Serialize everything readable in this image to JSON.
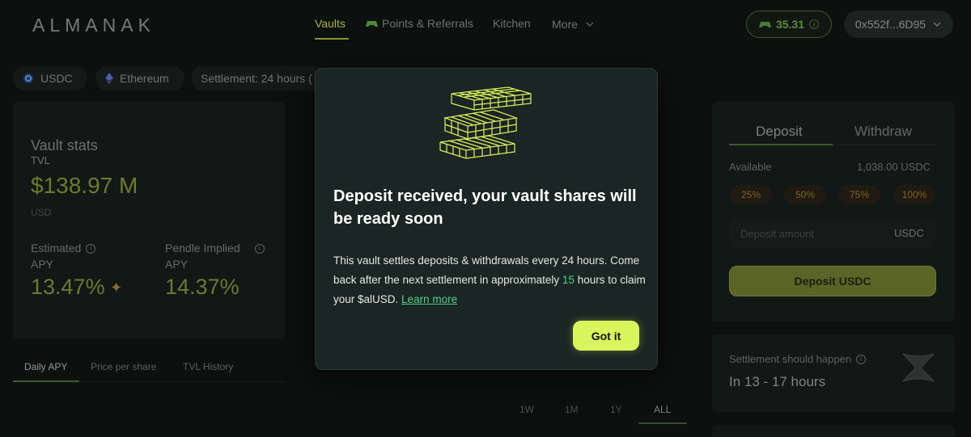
{
  "header": {
    "logo": "ALMANAK",
    "nav": [
      {
        "label": "Vaults",
        "active": true
      },
      {
        "label": "Points & Referrals",
        "icon": "gamepad-icon"
      },
      {
        "label": "Kitchen"
      },
      {
        "label": "More",
        "icon": "chevron-down-icon"
      }
    ],
    "points": "35.31",
    "wallet": "0x552f...6D95"
  },
  "filters": {
    "asset": "USDC",
    "network": "Ethereum",
    "settlement": "Settlement: 24 hours ("
  },
  "stats": {
    "title": "Vault stats",
    "tvl_label": "TVL",
    "tvl_value": "$138.97 M",
    "tvl_unit": "USD",
    "estimated_label_1": "Estimated",
    "estimated_label_2": "APY",
    "estimated_value": "13.47%",
    "pendle_label_1": "Pendle Implied",
    "pendle_label_2": "APY",
    "pendle_value": "14.37%"
  },
  "chart_tabs": [
    "Daily APY",
    "Price per share",
    "TVL History"
  ],
  "ranges": [
    "1W",
    "1M",
    "1Y",
    "ALL"
  ],
  "deposit_panel": {
    "tabs": [
      "Deposit",
      "Withdraw"
    ],
    "available_label": "Available",
    "available_value": "1,038.00 USDC",
    "percentages": [
      "25%",
      "50%",
      "75%",
      "100%"
    ],
    "amount_placeholder": "Deposit amount",
    "amount_unit": "USDC",
    "button": "Deposit USDC"
  },
  "settlement_card": {
    "label": "Settlement should happen",
    "value": "In 13 - 17 hours"
  },
  "modal": {
    "title": "Deposit received, your vault shares will be ready soon",
    "body_1": "This vault settles deposits & withdrawals every 24 hours. Come back after the next settlement in approximately ",
    "body_hours": "15",
    "body_2": " hours to claim your $alUSD. ",
    "link": "Learn more",
    "button": "Got it"
  },
  "colors": {
    "accent": "#d9f55e",
    "highlight": "#4ad48a",
    "background": "#0c100f",
    "modal": "#1b2523"
  }
}
